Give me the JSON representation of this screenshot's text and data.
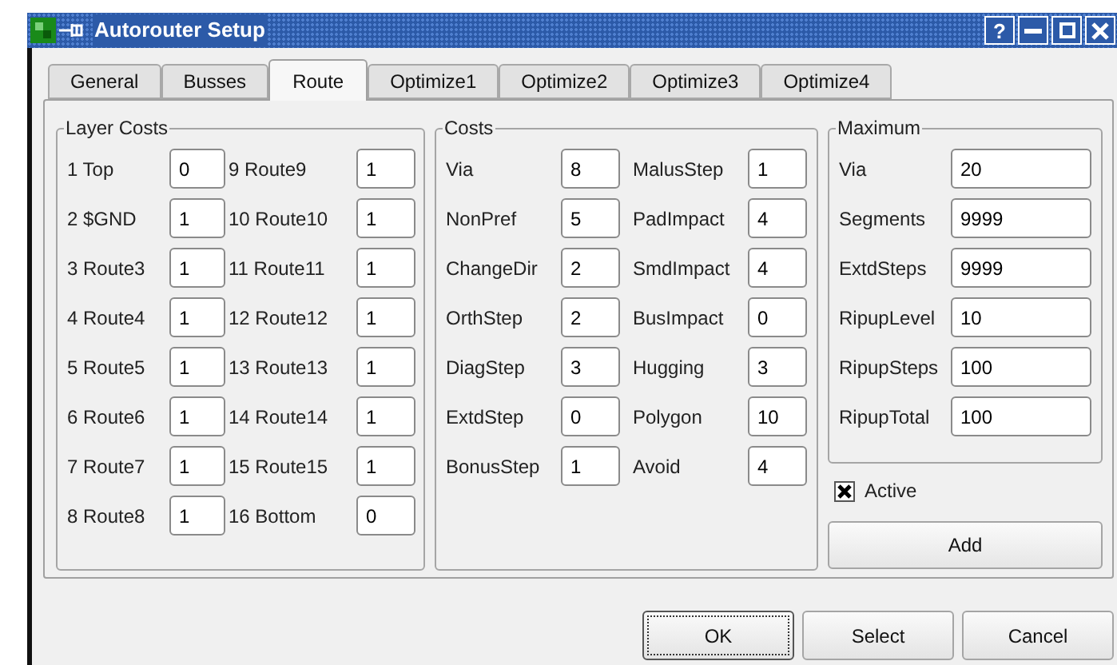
{
  "window": {
    "title": "Autorouter Setup",
    "help": "?"
  },
  "tabs": [
    {
      "label": "General",
      "selected": false
    },
    {
      "label": "Busses",
      "selected": false
    },
    {
      "label": "Route",
      "selected": true
    },
    {
      "label": "Optimize1",
      "selected": false
    },
    {
      "label": "Optimize2",
      "selected": false
    },
    {
      "label": "Optimize3",
      "selected": false
    },
    {
      "label": "Optimize4",
      "selected": false
    }
  ],
  "layer_costs": {
    "title": "Layer Costs",
    "rows": [
      {
        "label": "1 Top",
        "value": "0"
      },
      {
        "label": "2 $GND",
        "value": "1"
      },
      {
        "label": "3 Route3",
        "value": "1"
      },
      {
        "label": "4 Route4",
        "value": "1"
      },
      {
        "label": "5 Route5",
        "value": "1"
      },
      {
        "label": "6 Route6",
        "value": "1"
      },
      {
        "label": "7 Route7",
        "value": "1"
      },
      {
        "label": "8 Route8",
        "value": "1"
      },
      {
        "label": "9 Route9",
        "value": "1"
      },
      {
        "label": "10 Route10",
        "value": "1"
      },
      {
        "label": "11 Route11",
        "value": "1"
      },
      {
        "label": "12 Route12",
        "value": "1"
      },
      {
        "label": "13 Route13",
        "value": "1"
      },
      {
        "label": "14 Route14",
        "value": "1"
      },
      {
        "label": "15 Route15",
        "value": "1"
      },
      {
        "label": "16 Bottom",
        "value": "0"
      }
    ]
  },
  "costs": {
    "title": "Costs",
    "rows": [
      {
        "label": "Via",
        "value": "8"
      },
      {
        "label": "NonPref",
        "value": "5"
      },
      {
        "label": "ChangeDir",
        "value": "2"
      },
      {
        "label": "OrthStep",
        "value": "2"
      },
      {
        "label": "DiagStep",
        "value": "3"
      },
      {
        "label": "ExtdStep",
        "value": "0"
      },
      {
        "label": "BonusStep",
        "value": "1"
      },
      {
        "label": "MalusStep",
        "value": "1"
      },
      {
        "label": "PadImpact",
        "value": "4"
      },
      {
        "label": "SmdImpact",
        "value": "4"
      },
      {
        "label": "BusImpact",
        "value": "0"
      },
      {
        "label": "Hugging",
        "value": "3"
      },
      {
        "label": "Polygon",
        "value": "10"
      },
      {
        "label": "Avoid",
        "value": "4"
      }
    ]
  },
  "maximum": {
    "title": "Maximum",
    "rows": [
      {
        "label": "Via",
        "value": "20"
      },
      {
        "label": "Segments",
        "value": "9999"
      },
      {
        "label": "ExtdSteps",
        "value": "9999"
      },
      {
        "label": "RipupLevel",
        "value": "10"
      },
      {
        "label": "RipupSteps",
        "value": "100"
      },
      {
        "label": "RipupTotal",
        "value": "100"
      }
    ]
  },
  "active": {
    "label": "Active",
    "checked": true
  },
  "add_button": "Add",
  "buttons": [
    {
      "label": "OK",
      "default": true
    },
    {
      "label": "Select",
      "default": false
    },
    {
      "label": "Cancel",
      "default": false
    }
  ]
}
